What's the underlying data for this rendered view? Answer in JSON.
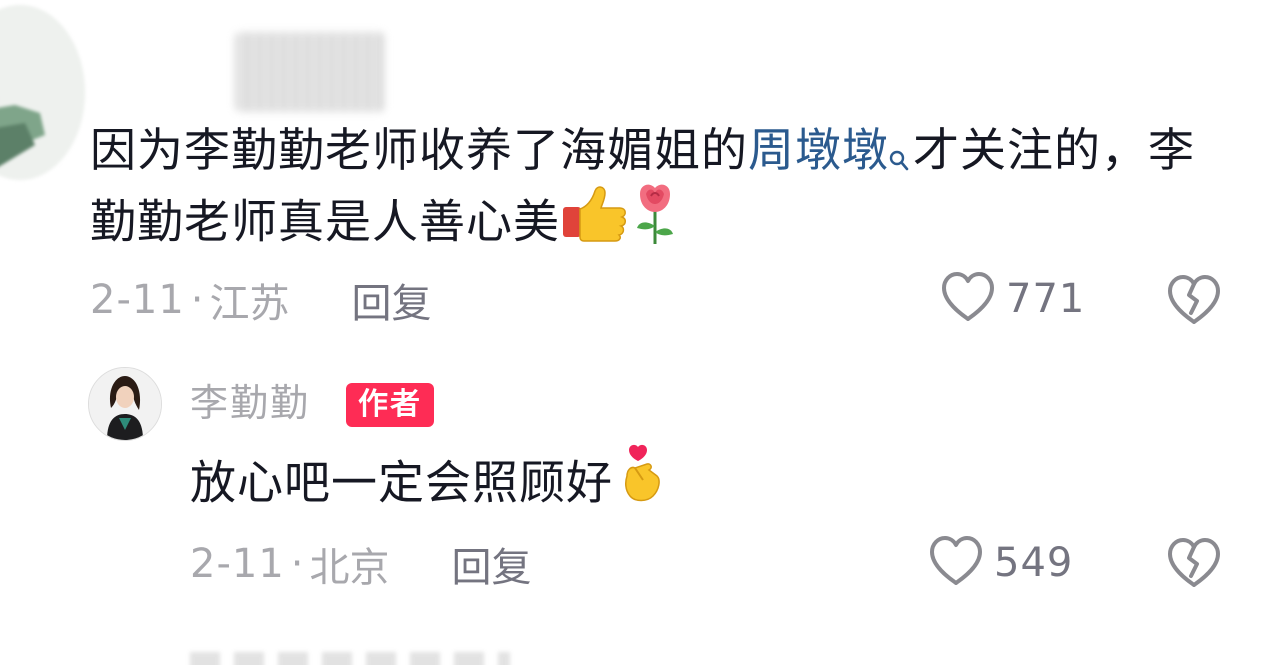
{
  "comment": {
    "text_before_mention": "因为李勤勤老师收养了海媚姐的",
    "mention": "周墩墩",
    "text_after_mention": "才关注的，李勤勤老师真是人善心美",
    "emojis": [
      "thumbs-up-emoji",
      "rose-emoji"
    ],
    "date": "2-11",
    "separator": "·",
    "location": "江苏",
    "reply_label": "回复",
    "like_count": "771"
  },
  "reply": {
    "author_name": "李勤勤",
    "author_badge": "作者",
    "text": "放心吧一定会照顾好",
    "emojis": [
      "finger-heart-emoji"
    ],
    "date": "2-11",
    "separator": "·",
    "location": "北京",
    "reply_label": "回复",
    "like_count": "549"
  },
  "icons": {
    "like": "heart-outline-icon",
    "dislike": "broken-heart-icon",
    "mention": "search-icon"
  },
  "colors": {
    "text_primary": "#161823",
    "text_secondary": "#a8a8ad",
    "mention_link": "#2b5a8e",
    "author_badge_bg": "#fe2c55"
  }
}
